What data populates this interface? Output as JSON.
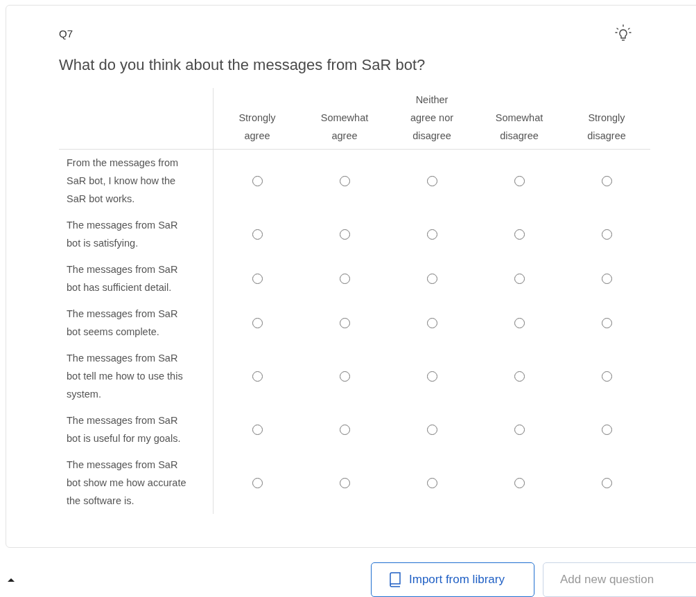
{
  "question": {
    "number": "Q7",
    "text": "What do you think about the messages from SaR bot?"
  },
  "columns": [
    "Strongly agree",
    "Somewhat agree",
    "Neither agree nor disagree",
    "Somewhat disagree",
    "Strongly disagree"
  ],
  "rows": [
    {
      "statement": "From the messages from SaR bot, I know how the SaR bot works.",
      "choices": [
        {
          "selected": false
        },
        {
          "selected": false
        },
        {
          "selected": false
        },
        {
          "selected": false
        },
        {
          "selected": false
        }
      ]
    },
    {
      "statement": "The messages from SaR bot is satisfying.",
      "choices": [
        {
          "selected": false
        },
        {
          "selected": false
        },
        {
          "selected": false
        },
        {
          "selected": false
        },
        {
          "selected": false
        }
      ]
    },
    {
      "statement": "The messages from SaR bot has sufficient detail.",
      "choices": [
        {
          "selected": false
        },
        {
          "selected": false
        },
        {
          "selected": false
        },
        {
          "selected": false
        },
        {
          "selected": false
        }
      ]
    },
    {
      "statement": "The messages from SaR bot seems complete.",
      "choices": [
        {
          "selected": false
        },
        {
          "selected": false
        },
        {
          "selected": false
        },
        {
          "selected": false
        },
        {
          "selected": false
        }
      ]
    },
    {
      "statement": "The messages from SaR bot tell me how to use this system.",
      "choices": [
        {
          "selected": false
        },
        {
          "selected": false
        },
        {
          "selected": false
        },
        {
          "selected": false
        },
        {
          "selected": false
        }
      ]
    },
    {
      "statement": "The messages from SaR bot is useful for my goals.",
      "choices": [
        {
          "selected": false
        },
        {
          "selected": false
        },
        {
          "selected": false
        },
        {
          "selected": false
        },
        {
          "selected": false
        }
      ]
    },
    {
      "statement": "The messages from SaR bot show me how accurate the software is.",
      "choices": [
        {
          "selected": false
        },
        {
          "selected": false
        },
        {
          "selected": false
        },
        {
          "selected": false
        },
        {
          "selected": false
        }
      ]
    }
  ],
  "buttons": [
    {
      "label": "Import from library",
      "kind": "primary"
    },
    {
      "label": "Add new question",
      "kind": "secondary"
    }
  ]
}
